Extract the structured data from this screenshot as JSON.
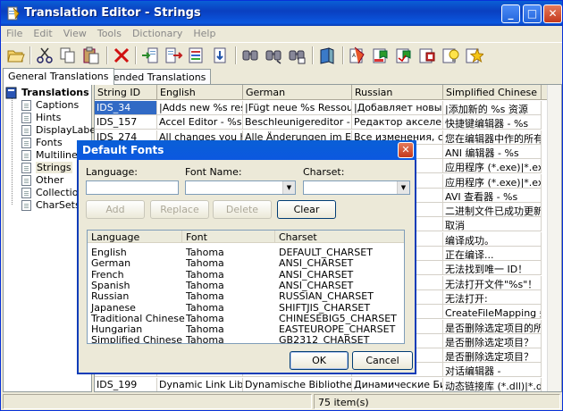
{
  "window": {
    "title": "Translation Editor - Strings",
    "min": "_",
    "max": "□",
    "close": "✕"
  },
  "menu": [
    "File",
    "Edit",
    "View",
    "Tools",
    "Dictionary",
    "Help"
  ],
  "tabs": {
    "general": "General Translations",
    "extended": "Extended Translations"
  },
  "tree": {
    "root": "Translations",
    "items": [
      "Captions",
      "Hints",
      "DisplayLabels",
      "Fonts",
      "Multilines",
      "Strings",
      "Other",
      "Collections",
      "CharSets"
    ]
  },
  "grid": {
    "headers": [
      "String ID",
      "English",
      "German",
      "Russian",
      "Simplified Chinese"
    ],
    "rows": [
      [
        "IDS_34",
        "|Adds new %s resource",
        "|Fügt  neue %s Ressource h",
        "|Добавляет новый %s",
        "|添加新的 %s 资源"
      ],
      [
        "IDS_157",
        "Accel Editor - %s",
        "Beschleunigereditor - %s",
        "Редактор акселератор",
        "快捷键编辑器 - %s"
      ],
      [
        "IDS_274",
        "All changes you have i",
        "Alle Änderungen im Editor we",
        "Все изменения, сделан",
        "您在编辑器中作的所有"
      ],
      [
        "",
        "",
        "",
        "%s",
        "ANI 编辑器 - %s"
      ],
      [
        "",
        "",
        "",
        "exe)|*.",
        "应用程序 (*.exe)|*.exe|"
      ],
      [
        "",
        "",
        "",
        "exe)|*.",
        "应用程序 (*.exe)|*.exe|"
      ],
      [
        "",
        "",
        "",
        "%s",
        "AVI 查看器 - %s"
      ],
      [
        "",
        "",
        "",
        "был ус",
        "二进制文件已成功更新"
      ],
      [
        "",
        "",
        "",
        "",
        "取消"
      ],
      [
        "",
        "",
        "",
        "успешн",
        "编译成功。"
      ],
      [
        "",
        "",
        "",
        "",
        "正在编译..."
      ],
      [
        "",
        "",
        "",
        "ти уни",
        "无法找到唯一 ID！"
      ],
      [
        "",
        "",
        "",
        "крыть ф",
        "无法打开文件\"%s\"！"
      ],
      [
        "",
        "",
        "",
        "крыть:",
        "无法打开:"
      ],
      [
        "",
        "",
        "",
        "Mapping",
        "CreateFileMapping 失败"
      ],
      [
        "",
        "",
        "",
        "элемен",
        "是否删除选定项目的所"
      ],
      [
        "",
        "",
        "",
        "ный эл",
        "是否删除选定项目？"
      ],
      [
        "",
        "",
        "",
        "ный эл",
        "是否删除选定项目？"
      ],
      [
        "",
        "",
        "",
        "ор -",
        "对话编辑器 -"
      ],
      [
        "IDS_199",
        "Dynamic Link Libraries",
        "Dynamische Bibliotheken (*.d",
        "Динамические Библиот",
        "动态链接库 (*.dll)|*.dll|所"
      ]
    ]
  },
  "status": {
    "count": "75 item(s)"
  },
  "dialog": {
    "title": "Default Fonts",
    "language_label": "Language:",
    "fontname_label": "Font Name:",
    "charset_label": "Charset:",
    "buttons": {
      "add": "Add",
      "replace": "Replace",
      "delete": "Delete",
      "clear": "Clear",
      "ok": "OK",
      "cancel": "Cancel"
    },
    "list_headers": [
      "Language",
      "Font",
      "Charset"
    ],
    "list_rows": [
      [
        "English",
        "Tahoma",
        "DEFAULT_CHARSET"
      ],
      [
        "German",
        "Tahoma",
        "ANSI_CHARSET"
      ],
      [
        "French",
        "Tahoma",
        "ANSI_CHARSET"
      ],
      [
        "Spanish",
        "Tahoma",
        "ANSI_CHARSET"
      ],
      [
        "Russian",
        "Tahoma",
        "RUSSIAN_CHARSET"
      ],
      [
        "Japanese",
        "Tahoma",
        "SHIFTJIS_CHARSET"
      ],
      [
        "Traditional Chinese",
        "Tahoma",
        "CHINESEBIG5_CHARSET"
      ],
      [
        "Hungarian",
        "Tahoma",
        "EASTEUROPE_CHARSET"
      ],
      [
        "Simplified Chinese",
        "Tahoma",
        "GB2312_CHARSET"
      ]
    ]
  },
  "toolbar_icons": [
    "open-icon",
    "cut-icon",
    "copy-icon",
    "paste-icon",
    "delete-icon",
    "import-icon",
    "export-icon",
    "import-file-icon",
    "export-file-icon",
    "find-icon",
    "find-next-icon",
    "replace-icon",
    "dictionary-icon",
    "translate-icon",
    "translate-all-icon",
    "auto-translate-icon",
    "options-icon",
    "tip-icon",
    "star-icon"
  ]
}
